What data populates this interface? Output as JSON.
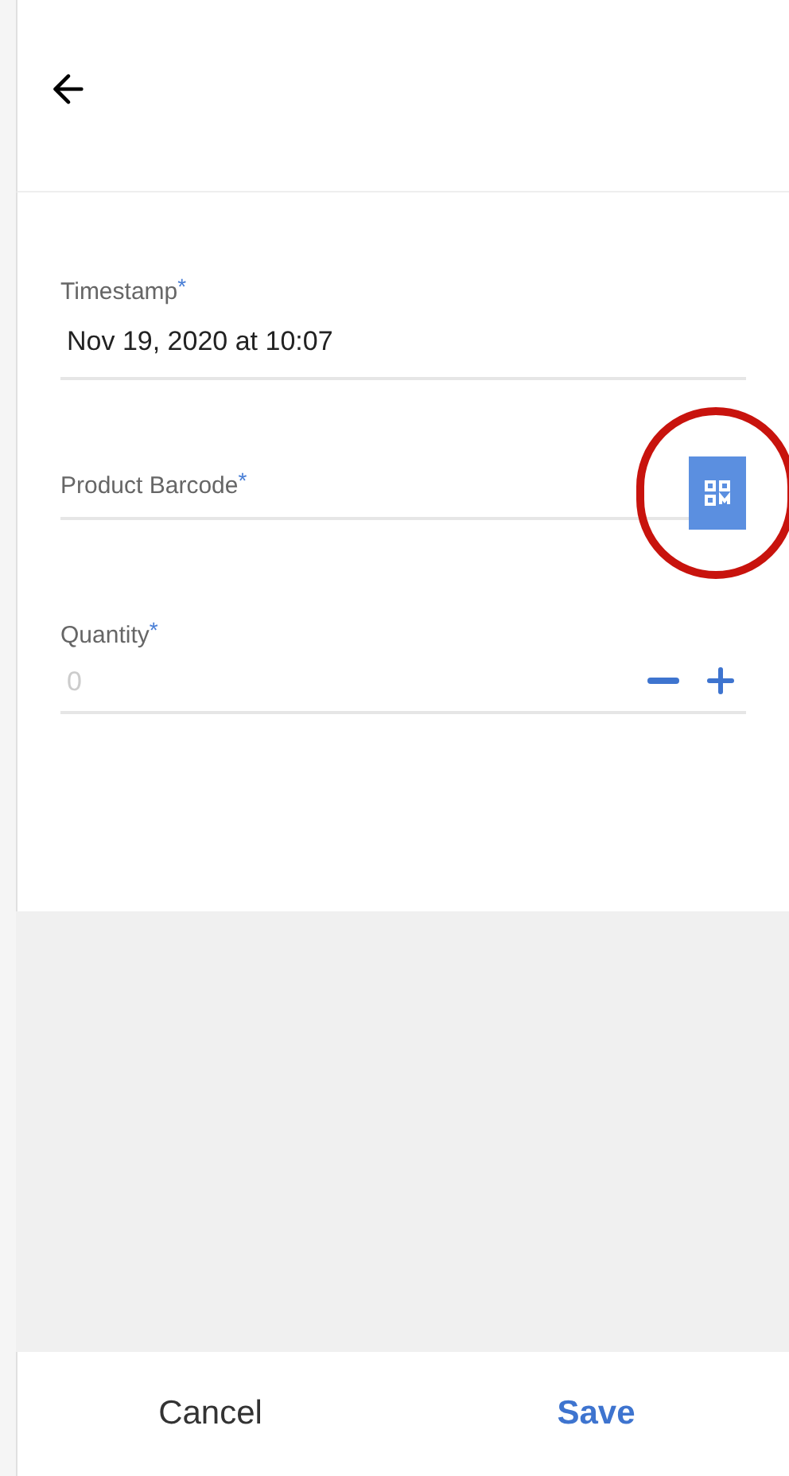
{
  "fields": [
    {
      "kind": "text",
      "label": "Timestamp",
      "required_mark": "*",
      "value": "Nov 19, 2020 at 10:07"
    },
    {
      "kind": "scan",
      "label": "Product Barcode",
      "required_mark": "*",
      "highlighted": true
    },
    {
      "kind": "stepper",
      "label": "Quantity",
      "required_mark": "*",
      "placeholder": "0"
    }
  ],
  "footer": {
    "buttons": [
      {
        "label": "Cancel",
        "primary": false
      },
      {
        "label": "Save",
        "primary": true
      }
    ]
  }
}
